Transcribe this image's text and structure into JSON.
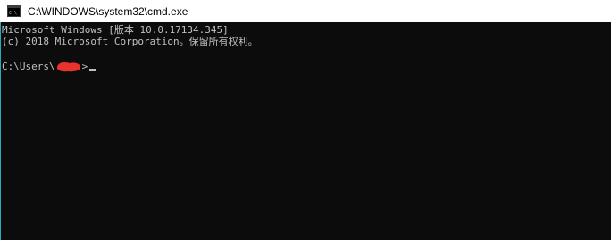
{
  "window": {
    "title": "C:\\WINDOWS\\system32\\cmd.exe",
    "icon": "cmd-icon"
  },
  "console": {
    "line1": "Microsoft Windows [版本 10.0.17134.345]",
    "line2": "(c) 2018 Microsoft Corporation。保留所有权利。",
    "prompt_prefix": "C:\\Users\\",
    "prompt_suffix": ">",
    "redaction_color": "#e8322d",
    "background_color": "#0c0c0c",
    "text_color": "#c0c0c0"
  }
}
